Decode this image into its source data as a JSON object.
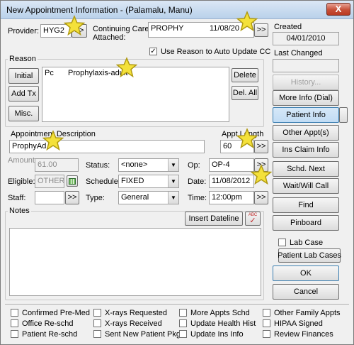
{
  "window": {
    "title": "New Appointment Information - (Palamalu, Manu)",
    "close_glyph": "X"
  },
  "provider": {
    "label": "Provider:",
    "value": "HYG2"
  },
  "continuing_care": {
    "label_line1": "Continuing Care",
    "label_line2": "Attached:",
    "value": "PROPHY",
    "date": "11/08/20"
  },
  "use_reason": {
    "label": "Use Reason to Auto Update CC",
    "checked": true
  },
  "reason": {
    "title": "Reason",
    "left_buttons": [
      "Initial",
      "Add Tx",
      "Misc."
    ],
    "right_buttons": [
      "Delete",
      "Del. All"
    ],
    "item_code": "Pc",
    "item_desc": "Prophylaxis-adult"
  },
  "description": {
    "label": "Appointment Description",
    "value": "ProphyAd"
  },
  "appt_length": {
    "label": "Appt Length",
    "value": "60"
  },
  "amount": {
    "label": "Amount:",
    "value": "61.00"
  },
  "eligible": {
    "label": "Eligible:",
    "value": "OTHER"
  },
  "staff": {
    "label": "Staff:",
    "value": ""
  },
  "status": {
    "label": "Status:",
    "value": "<none>"
  },
  "schedule": {
    "label": "Schedule:",
    "value": "FIXED"
  },
  "type": {
    "label": "Type:",
    "value": "General"
  },
  "op": {
    "label": "Op:",
    "value": "OP-4"
  },
  "date": {
    "label": "Date:",
    "value": "11/08/2012"
  },
  "time": {
    "label": "Time:",
    "value": "12:00pm"
  },
  "notes": {
    "title": "Notes",
    "insert_dateline": "Insert Dateline",
    "spell_label": "ABC"
  },
  "right_panel": {
    "created_label": "Created",
    "created_value": "04/01/2010",
    "last_changed_label": "Last Changed",
    "buttons": {
      "history": "History...",
      "more_info": "More Info (Dial)",
      "patient_info": "Patient Info",
      "other_appts": "Other Appt(s)",
      "ins_claim": "Ins Claim Info",
      "schd_next": "Schd. Next",
      "wait_call": "Wait/Will Call",
      "find": "Find",
      "pinboard": "Pinboard",
      "patient_lab_cases": "Patient Lab Cases",
      "ok": "OK",
      "cancel": "Cancel"
    },
    "lab_case_label": "Lab Case"
  },
  "checkboxes": [
    [
      "Confirmed Pre-Med",
      "Office Re-schd",
      "Patient Re-schd"
    ],
    [
      "X-rays Requested",
      "X-rays Received",
      "Sent New Patient Pkg"
    ],
    [
      "More Appts Schd",
      "Update Health Hist",
      "Update Ins Info"
    ],
    [
      "Other Family Appts",
      "HIPAA Signed",
      "Review Finances"
    ]
  ],
  "browse_glyph": ">>",
  "colors": {
    "star_fill": "#f4e13a",
    "star_stroke": "#b09a12",
    "close_red": "#c75038"
  }
}
